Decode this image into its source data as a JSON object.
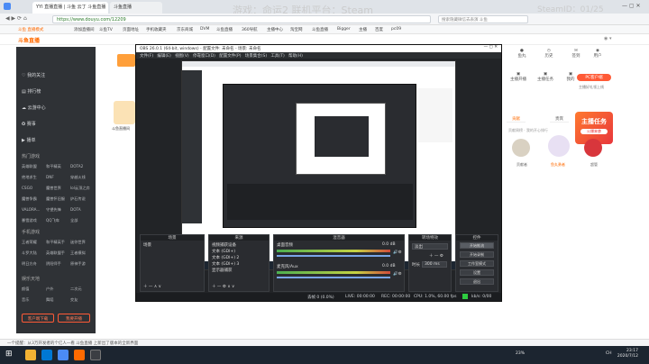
{
  "browser": {
    "tabs": [
      {
        "label": "YYI 直播直播 | 斗鱼 云丁 斗鱼直播"
      },
      {
        "label": "斗鱼直播"
      }
    ],
    "url": "https://www.douyu.com/12209",
    "search_placeholder": "搜索隐藏微信去表演 斗鱼",
    "bookmarks": [
      "斗鱼 直播模式",
      "添加直播间",
      "斗鱼TV",
      "页面地址",
      "手机收藏夹",
      "京东商城",
      "DVM",
      "斗鱼直播",
      "360导航",
      "主播中心",
      "淘宝网",
      "斗鱼直播",
      "Bigger",
      "主播",
      "百度",
      "pc09"
    ]
  },
  "overlay": {
    "game_text": "游戏：命运2  联机平台：Steam",
    "steam_text": "SteamID：01/25"
  },
  "site": {
    "logo": "斗鱼直播",
    "nav": {
      "top_items": [
        "我的关注",
        "排行榜",
        "云游中心",
        "赛事",
        "播单"
      ],
      "section_hot": "热门游戏",
      "hot_games": [
        [
          "英雄联盟",
          "和平精英",
          "DOTA2"
        ],
        [
          "绝地求生",
          "DNF",
          "穿越火线"
        ],
        [
          "CSGO",
          "魔兽世界",
          "lol云顶之弈"
        ],
        [
          "魔兽争霸",
          "魔兽怀旧服",
          "炉石传说"
        ],
        [
          "VALORA...",
          "守望先锋",
          "DOTA"
        ],
        [
          "暴雪游戏",
          "QQ飞车",
          "全部"
        ]
      ],
      "section_mobile": "手机游戏",
      "mobile_games": [
        [
          "王者荣耀",
          "和平精英手",
          "迷你世界"
        ],
        [
          "斗罗大陆",
          "英雄联盟手",
          "王者模拟"
        ],
        [
          "明日方舟",
          "阴阳师手",
          "原神手游"
        ]
      ],
      "section_ent": "娱乐天地",
      "ent_items": [
        [
          "颜值",
          "户外",
          "二次元"
        ],
        [
          "音乐",
          "舞蹈",
          "交友"
        ]
      ],
      "btn_left": "客户端下载",
      "btn_right": "我要开播"
    },
    "right": {
      "icons": [
        "鱼丸",
        "历史",
        "签到",
        "用户"
      ],
      "links": [
        "主播开播",
        "主播任务",
        "我的",
        "管理"
      ],
      "pc_badge": "PC客户端",
      "pc_sub": "主播好礼领上线",
      "tabs": [
        "贡献",
        "贵宾",
        "粉丝团"
      ],
      "subhead": "贡献周榜 · 我的开心排行",
      "promo": "主播任务",
      "promo_sub": "火爆来袭",
      "users": [
        "贡献者",
        "鱼丸勇者",
        "超管"
      ]
    },
    "streamer_tile": "斗鱼直播间"
  },
  "obs": {
    "title": "OBS 26.0.1 (64-bit, windows) - 配置文件: 未命名 - 场景: 未命名",
    "menu": [
      "文件(F)",
      "编辑(E)",
      "视图(V)",
      "停靠窗口(D)",
      "配置文件(P)",
      "场景集合(S)",
      "工具(T)",
      "帮助(H)"
    ],
    "panels": {
      "scenes": "场景",
      "sources": "来源",
      "mixer": "混音器",
      "transitions": "转场特效",
      "controls": "控件"
    },
    "scene_items": [
      "场景"
    ],
    "source_items": [
      "视频捕获设备",
      "文本 (GDI+)",
      "文本 (GDI+) 2",
      "文本 (GDI+) 3",
      "显示器捕获"
    ],
    "mixer_items": [
      {
        "name": "桌面音频",
        "level": "0.0 dB"
      },
      {
        "name": "麦克风/Aux",
        "level": "0.0 dB"
      }
    ],
    "transition": {
      "type": "淡出",
      "duration_label": "时长",
      "duration": "300 ms"
    },
    "buttons": [
      "开始推流",
      "开始录制",
      "工作室模式",
      "设置",
      "退出"
    ],
    "status": {
      "dropped": "丢帧 0 (0.0%)",
      "live": "LIVE: 00:00:00",
      "rec": "REC: 00:00:00",
      "cpu": "CPU: 1.0%, 60.00 fps",
      "kbps": "kb/s: 0/00"
    }
  },
  "taskbar": {
    "status_text": "一个提醒：从3万开发者的个亿人一看 斗鱼直播 上新出了版本的全新界面",
    "time": "23:17",
    "date": "2020/7/12",
    "net": "23%",
    "lang": "CH"
  },
  "colors": {
    "accent": "#ff6a00",
    "obs_bg": "#222427",
    "nav_bg": "#2f3236",
    "taskbar": "#1c2530"
  }
}
